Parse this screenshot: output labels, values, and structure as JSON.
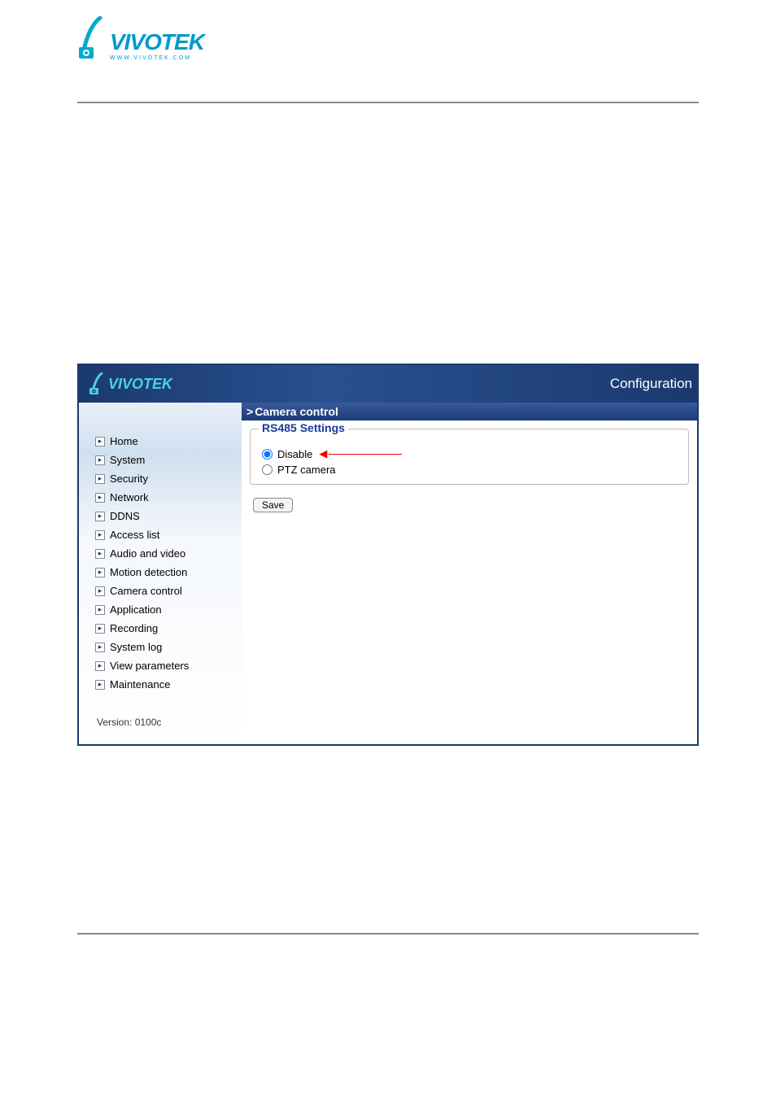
{
  "page_logo": {
    "brand": "VIVOTEK",
    "tagline": "WWW.VIVOTEK.COM"
  },
  "app": {
    "header": {
      "brand": "VIVOTEK",
      "config_label": "Configuration"
    },
    "sidebar": {
      "items": [
        {
          "label": "Home"
        },
        {
          "label": "System"
        },
        {
          "label": "Security"
        },
        {
          "label": "Network"
        },
        {
          "label": "DDNS"
        },
        {
          "label": "Access list"
        },
        {
          "label": "Audio and video"
        },
        {
          "label": "Motion detection"
        },
        {
          "label": "Camera control"
        },
        {
          "label": "Application"
        },
        {
          "label": "Recording"
        },
        {
          "label": "System log"
        },
        {
          "label": "View parameters"
        },
        {
          "label": "Maintenance"
        }
      ],
      "version_label": "Version: 0100c"
    },
    "main": {
      "title": "Camera control",
      "fieldset_title": "RS485 Settings",
      "radio_disable": "Disable",
      "radio_ptz": "PTZ camera",
      "save_label": "Save"
    }
  }
}
